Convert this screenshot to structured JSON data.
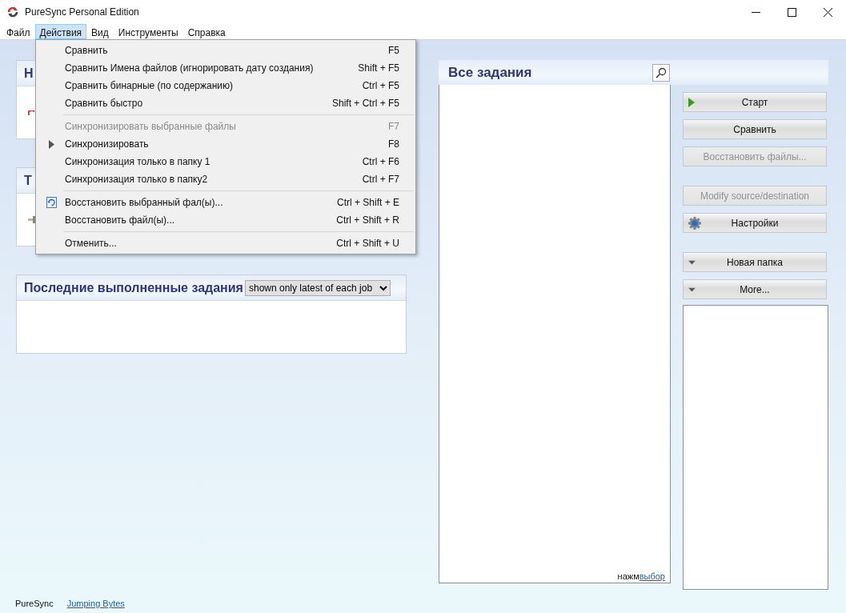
{
  "window": {
    "title": "PureSync Personal Edition"
  },
  "menu_bar": [
    {
      "label": "Файл",
      "selected": false
    },
    {
      "label": "Действия",
      "selected": true
    },
    {
      "label": "Вид",
      "selected": false
    },
    {
      "label": "Инструменты",
      "selected": false
    },
    {
      "label": "Справка",
      "selected": false
    }
  ],
  "dropdown_menu": [
    {
      "kind": "item",
      "label": "Сравнить",
      "shortcut": "F5",
      "disabled": false
    },
    {
      "kind": "item",
      "label": "Сравнить Имена файлов (игнорировать дату создания)",
      "shortcut": "Shift + F5",
      "disabled": false
    },
    {
      "kind": "item",
      "label": "Сравнить бинарные (по содержанию)",
      "shortcut": "Ctrl + F5",
      "disabled": false
    },
    {
      "kind": "item",
      "label": "Сравнить быстро",
      "shortcut": "Shift + Ctrl + F5",
      "disabled": false
    },
    {
      "kind": "separator"
    },
    {
      "kind": "item",
      "label": "Синхронизировать выбранные файлы",
      "shortcut": "F7",
      "disabled": true
    },
    {
      "kind": "play_item",
      "label": "Синхронизировать",
      "shortcut": "F8",
      "disabled": false
    },
    {
      "kind": "item",
      "label": "Синхронизация только в папку 1",
      "shortcut": "Ctrl + F6",
      "disabled": false
    },
    {
      "kind": "item",
      "label": "Синхронизация только в папку2",
      "shortcut": "Ctrl + F7",
      "disabled": false
    },
    {
      "kind": "separator"
    },
    {
      "kind": "restore_item",
      "label": "Восстановить выбранный фал(ы)...",
      "shortcut": "Ctrl + Shift + E",
      "disabled": false
    },
    {
      "kind": "item",
      "label": "Восстановить файл(ы)...",
      "shortcut": "Ctrl + Shift + R",
      "disabled": false
    },
    {
      "kind": "separator"
    },
    {
      "kind": "item",
      "label": "Отменить...",
      "shortcut": "Ctrl + Shift + U",
      "disabled": false
    }
  ],
  "left_panels": [
    {
      "title": "Н"
    },
    {
      "title": "Т"
    }
  ],
  "recent_jobs": {
    "title": "Последние выполненные задания",
    "filter": "shown only latest of each job"
  },
  "all_jobs": {
    "title": "Все задания",
    "hint": "нажм",
    "link": "выбор"
  },
  "buttons": [
    {
      "kind": "play",
      "label": "Старт",
      "disabled": false
    },
    {
      "kind": "plain",
      "label": "Сравнить",
      "disabled": false
    },
    {
      "kind": "plain",
      "label": "Восстановить файлы...",
      "disabled": true
    },
    {
      "kind": "plain",
      "label": "Modify source/destination",
      "disabled": true
    },
    {
      "kind": "settings",
      "label": "Настройки",
      "disabled": false
    },
    {
      "kind": "dropdown",
      "label": "Новая папка",
      "disabled": false
    },
    {
      "kind": "dropdown",
      "label": "More...",
      "disabled": false
    }
  ],
  "footer": {
    "app": "PureSync",
    "link": "Jumping Bytes"
  }
}
